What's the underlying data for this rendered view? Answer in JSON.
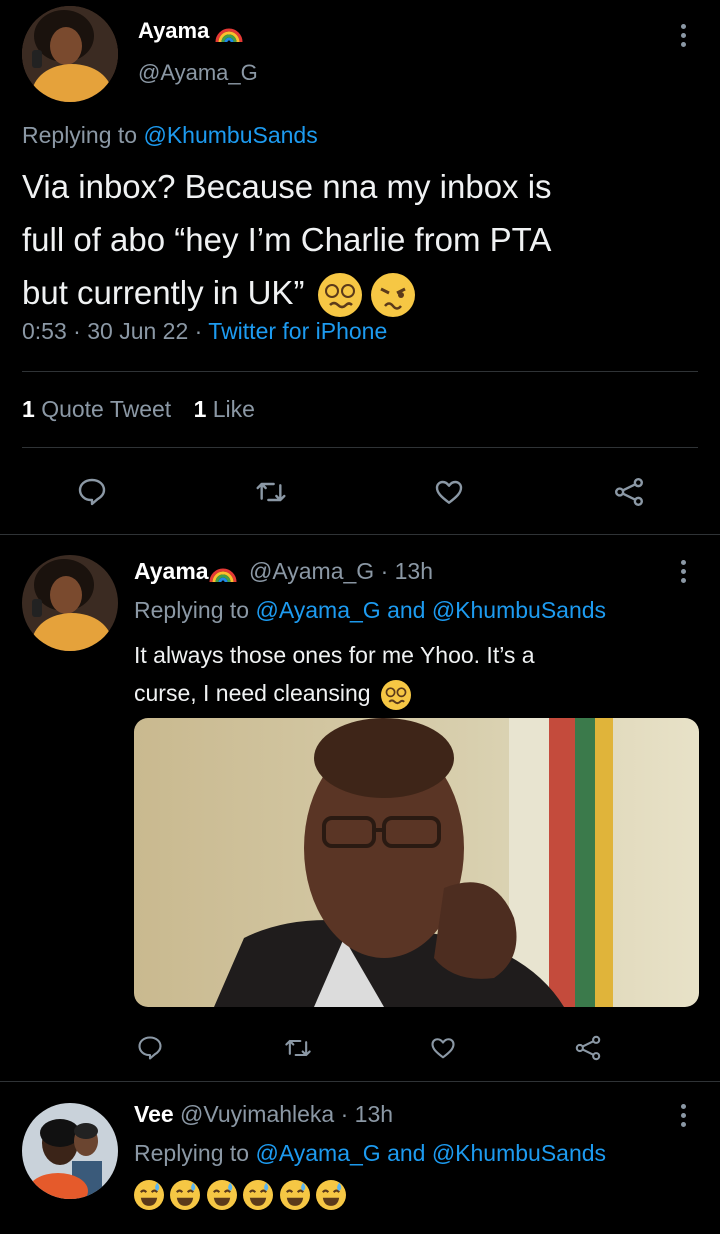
{
  "main_tweet": {
    "author_name": "Ayama",
    "author_handle": "@Ayama_G",
    "replying_prefix": "Replying to",
    "replying_to": "@KhumbuSands",
    "text_line1": "Via inbox? Because nna my inbox is",
    "text_line2": "full of abo “hey I’m Charlie from PTA",
    "text_line3": "but currently in UK”",
    "time": "0:53",
    "date": "30 Jun 22",
    "source": "Twitter for iPhone",
    "quote_count": "1",
    "quote_label": "Quote Tweet",
    "like_count": "1",
    "like_label": "Like"
  },
  "reply1": {
    "author_name": "Ayama",
    "author_handle": "@Ayama_G",
    "time": "13h",
    "replying_prefix": "Replying to",
    "replying_to_1": "@Ayama_G",
    "and_word": "and",
    "replying_to_2": "@KhumbuSands",
    "text_line1": "It always those ones for me Yhoo. It’s a",
    "text_line2": "curse, I need cleansing"
  },
  "reply2": {
    "author_name": "Vee",
    "author_handle": "@Vuyimahleka",
    "time": "13h",
    "replying_prefix": "Replying to",
    "replying_to_1": "@Ayama_G",
    "and_word": "and",
    "replying_to_2": "@KhumbuSands"
  },
  "separator": "·",
  "colors": {
    "background": "#000000",
    "text": "#e7e9ea",
    "muted": "#8b98a5",
    "link": "#1d9bf0",
    "divider": "#2f3336"
  },
  "icons": [
    "reply-icon",
    "retweet-icon",
    "like-icon",
    "share-icon",
    "more-icon",
    "rainbow-icon"
  ]
}
